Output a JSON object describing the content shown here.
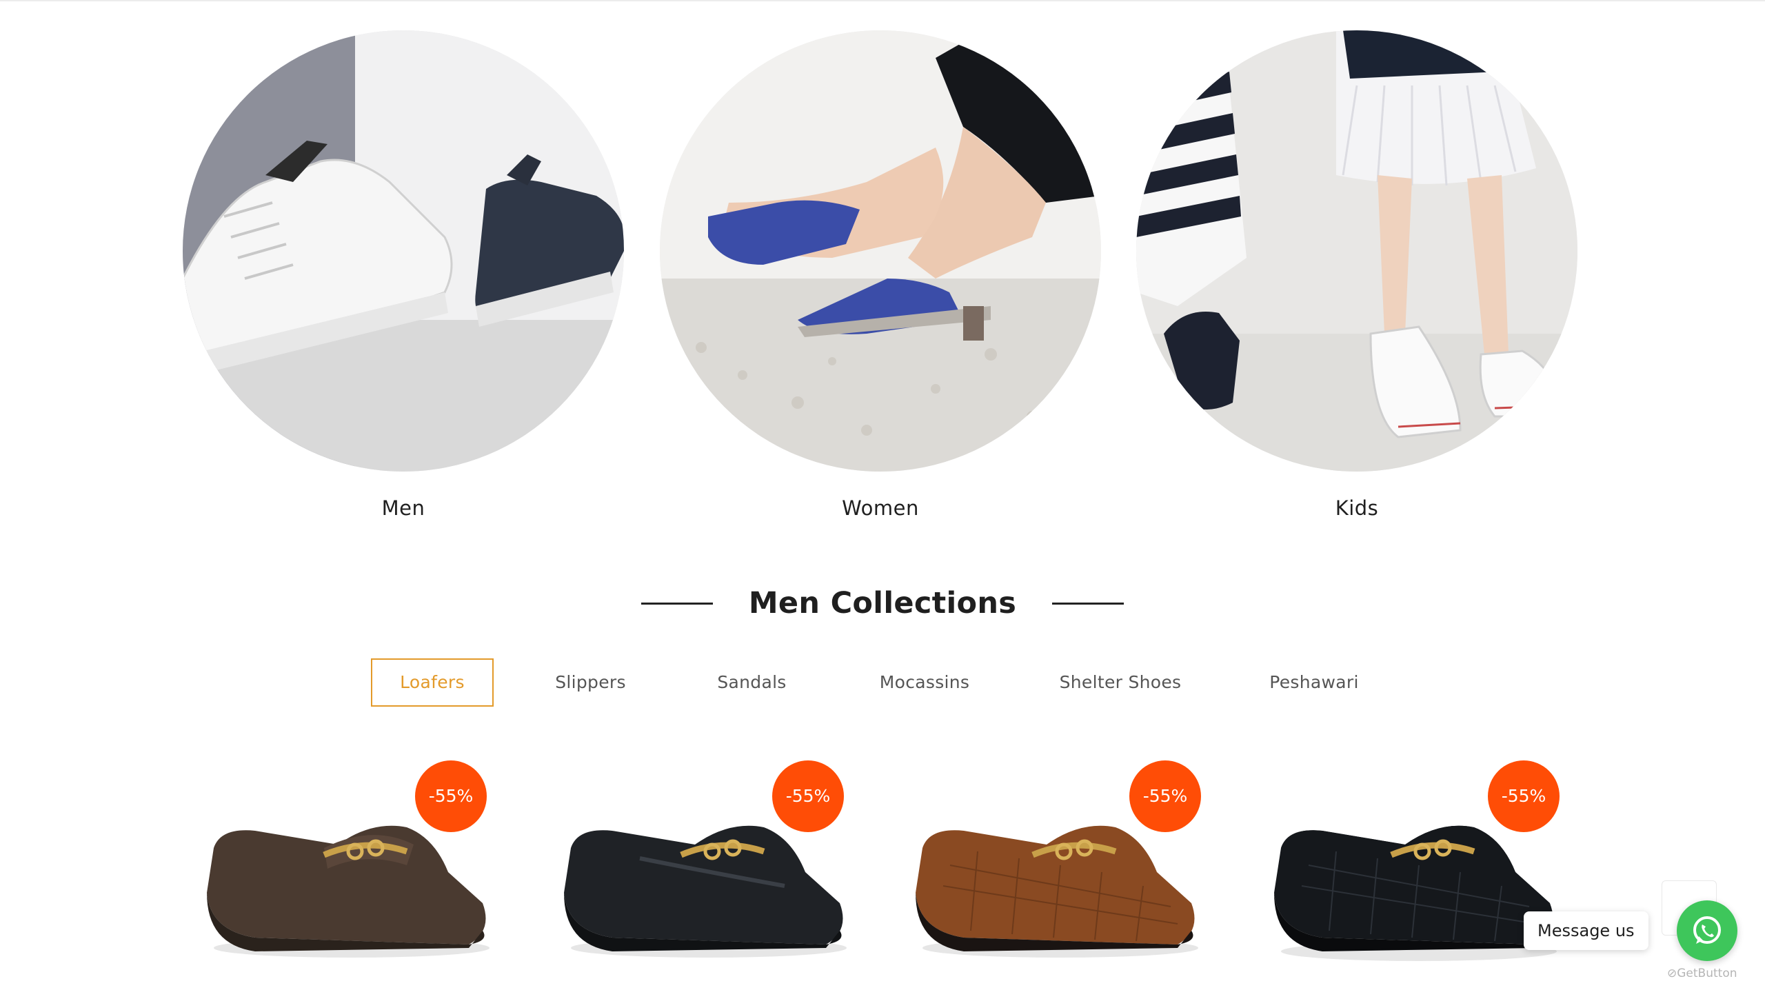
{
  "categories": [
    {
      "label": "Men"
    },
    {
      "label": "Women"
    },
    {
      "label": "Kids"
    }
  ],
  "section": {
    "title": "Men Collections"
  },
  "tabs": [
    {
      "label": "Loafers",
      "active": true
    },
    {
      "label": "Slippers",
      "active": false
    },
    {
      "label": "Sandals",
      "active": false
    },
    {
      "label": "Mocassins",
      "active": false
    },
    {
      "label": "Shelter Shoes",
      "active": false
    },
    {
      "label": "Peshawari",
      "active": false
    }
  ],
  "products": [
    {
      "badge": "-55%",
      "color": "#4a3a30"
    },
    {
      "badge": "-55%",
      "color": "#1f2226"
    },
    {
      "badge": "-55%",
      "color": "#8a4a22"
    },
    {
      "badge": "-55%",
      "color": "#15181c"
    }
  ],
  "chat": {
    "message_label": "Message us",
    "powered_by": "GetButton"
  },
  "colors": {
    "accent": "#e39a2a",
    "badge": "#ff4d06",
    "whatsapp": "#3ec65b"
  }
}
